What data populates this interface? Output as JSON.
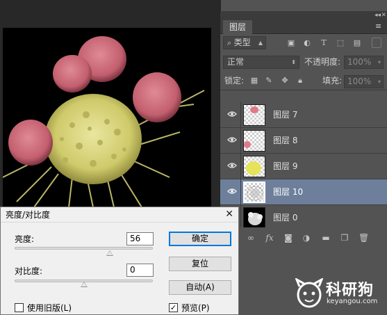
{
  "panel": {
    "tab_label": "图层",
    "filter_type": "类型",
    "blend_mode": "正常",
    "opacity_label": "不透明度:",
    "opacity_value": "100%",
    "lock_label": "锁定:",
    "fill_label": "填充:",
    "fill_value": "100%"
  },
  "layers": [
    {
      "name": "图层 7",
      "selected": false,
      "visible": true
    },
    {
      "name": "图层 8",
      "selected": false,
      "visible": true
    },
    {
      "name": "图层 9",
      "selected": false,
      "visible": true
    },
    {
      "name": "图层 10",
      "selected": true,
      "visible": true
    },
    {
      "name": "图层 0",
      "selected": false,
      "visible": false
    }
  ],
  "dialog": {
    "title": "亮度/对比度",
    "brightness_label": "亮度:",
    "brightness_value": "56",
    "contrast_label": "对比度:",
    "contrast_value": "0",
    "ok_label": "确定",
    "reset_label": "复位",
    "auto_label": "自动(A)",
    "legacy_label": "使用旧版(L)",
    "legacy_checked": false,
    "preview_label": "预览(P)",
    "preview_checked": true
  },
  "watermark": {
    "title": "科研狗",
    "url": "keyangou.com"
  },
  "colors": {
    "cell_yellow": "#d6d27a",
    "cell_red": "#c86a78",
    "selected_layer": "#6d7f9b"
  }
}
